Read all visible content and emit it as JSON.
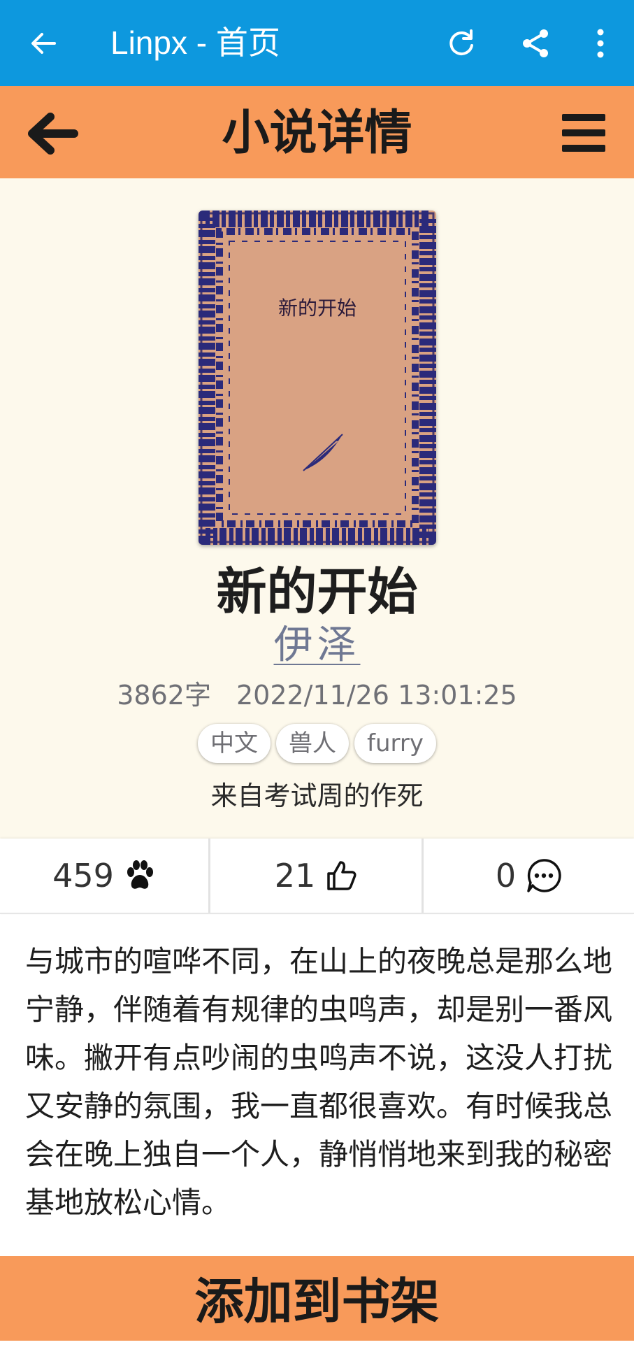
{
  "appbar": {
    "title": "Linpx - 首页",
    "icons": [
      "arrow-left-icon",
      "refresh-icon",
      "share-icon",
      "more-vertical-icon"
    ]
  },
  "header": {
    "title": "小说详情",
    "icons": [
      "arrow-left-icon",
      "menu-icon"
    ]
  },
  "novel": {
    "cover_title": "新的开始",
    "title": "新的开始",
    "author": "伊泽",
    "word_count": "3862字",
    "date": "2022/11/26 13:01:25",
    "tags": [
      "中文",
      "兽人",
      "furry"
    ],
    "description": "来自考试周的作死"
  },
  "stats": {
    "views": "459",
    "likes": "21",
    "comments": "0",
    "icons": [
      "paw-icon",
      "thumbs-up-icon",
      "comment-icon"
    ]
  },
  "excerpt": "与城市的喧哗不同，在山上的夜晚总是那么地宁静，伴随着有规律的虫鸣声，却是别一番风味。撇开有点吵闹的虫鸣声不说，这没人打扰又安静的氛围，我一直都很喜欢。有时候我总会在晚上独自一个人，静悄悄地来到我的秘密基地放松心情。",
  "actions": {
    "add_to_shelf": "添加到书架"
  },
  "colors": {
    "appbar": "#0d98de",
    "accent": "#f89a5a",
    "detail_bg": "#fdf9ec",
    "cover": "#d9a283",
    "cover_ornament": "#2b2a7a"
  }
}
